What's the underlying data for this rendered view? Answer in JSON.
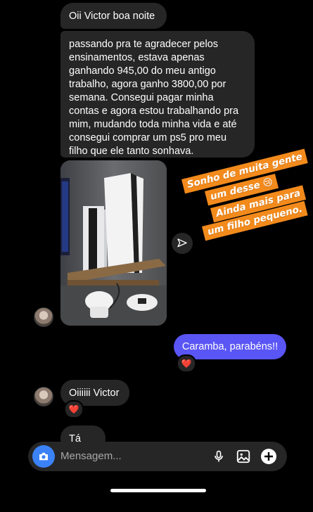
{
  "messages": {
    "m1": "Oii Victor boa noite",
    "m2": "passando pra te agradecer pelos ensinamentos, estava apenas ganhando 945,00 do meu antigo trabalho, agora ganho 3800,00 por semana. Consegui pagar minha contas e agora estou trabalhando pra mim, mudando toda minha vida e até consegui comprar um ps5 pro meu filho que ele tanto sonhava.",
    "sent": "Caramba, parabéns!!",
    "m3": "Oiiiiii Victor",
    "m4": "Tá aí?"
  },
  "stickers": {
    "s1_line1": "Sonho de muita gente",
    "s1_line2": "um desse 😢",
    "s2_line1": "Ainda mais para",
    "s2_line2": "um filho pequeno."
  },
  "reactions": {
    "heart": "❤️"
  },
  "composer": {
    "placeholder": "Mensagem..."
  },
  "colors": {
    "sent_bubble": "#5a55f5",
    "received_bubble": "#262626",
    "sticker": "#f28a1c",
    "camera_button": "#3b82f6"
  }
}
